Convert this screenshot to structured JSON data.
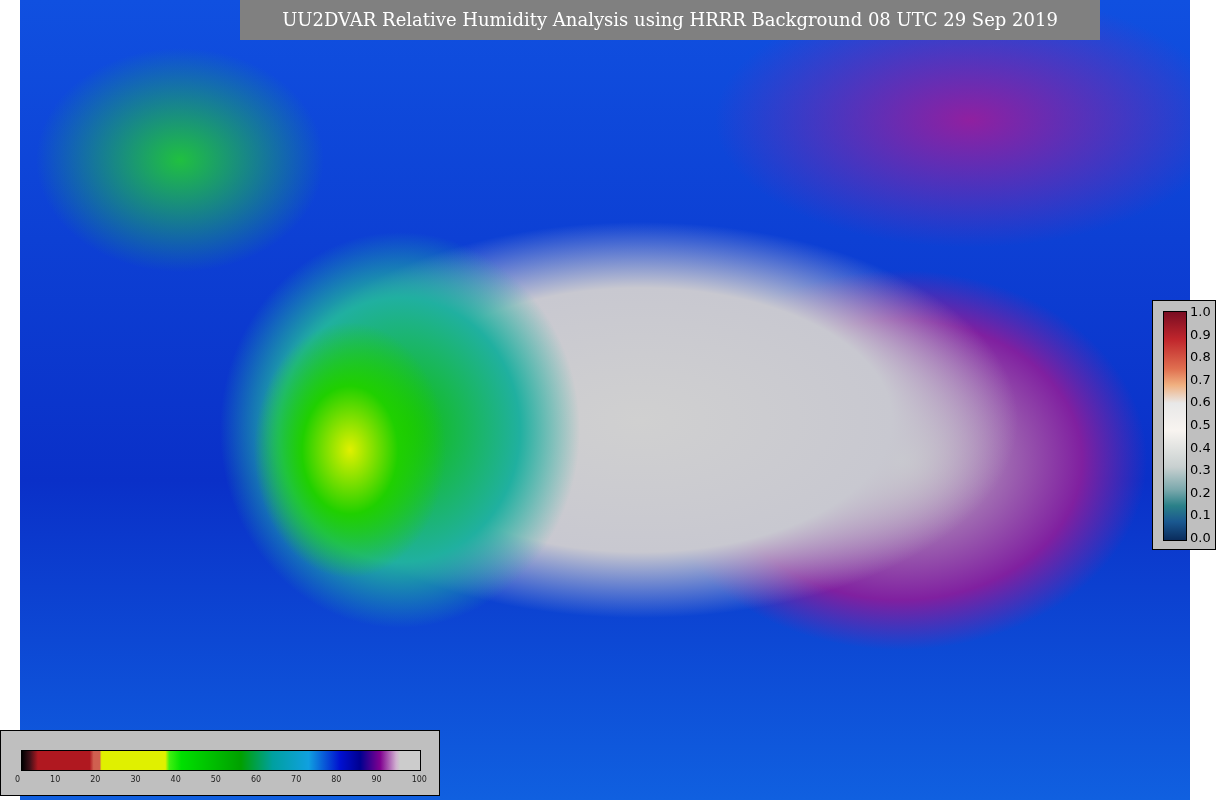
{
  "title": "UU2DVAR Relative Humidity Analysis using HRRR Background 08 UTC 29 Sep 2019",
  "map": {
    "kind": "humidity-field"
  },
  "colorbar_vertical": {
    "ticks": [
      "1.0",
      "0.9",
      "0.8",
      "0.7",
      "0.6",
      "0.5",
      "0.4",
      "0.3",
      "0.2",
      "0.1",
      "0.0"
    ]
  },
  "colorbar_horizontal": {
    "ticks": [
      "0",
      "10",
      "20",
      "30",
      "40",
      "50",
      "60",
      "70",
      "80",
      "90",
      "100"
    ]
  }
}
